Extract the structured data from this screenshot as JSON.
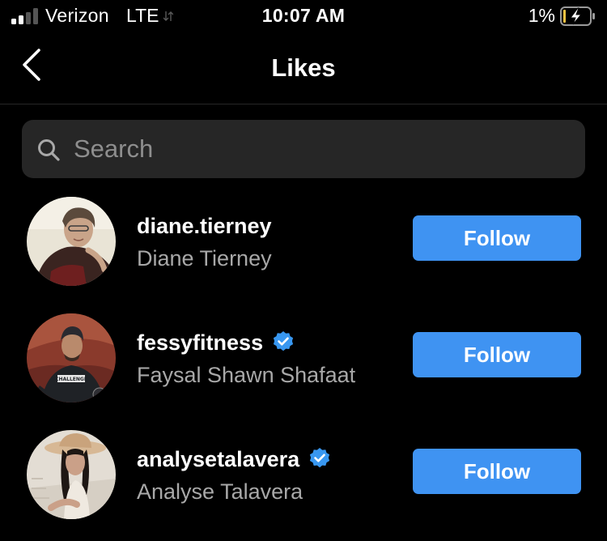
{
  "status_bar": {
    "carrier": "Verizon",
    "network": "LTE",
    "time": "10:07 AM",
    "battery": "1%",
    "signal_bars_filled": 2,
    "signal_bars_total": 4
  },
  "nav": {
    "title": "Likes",
    "back_icon": "chevron-left-icon"
  },
  "search": {
    "placeholder": "Search",
    "value": ""
  },
  "likes": [
    {
      "username": "diane.tierney",
      "full_name": "Diane Tierney",
      "verified": false,
      "button_label": "Follow"
    },
    {
      "username": "fessyfitness",
      "full_name": "Faysal Shawn Shafaat",
      "verified": true,
      "button_label": "Follow"
    },
    {
      "username": "analysetalavera",
      "full_name": "Analyse Talavera",
      "verified": true,
      "button_label": "Follow"
    }
  ],
  "colors": {
    "background": "#000000",
    "search_background": "#262626",
    "follow_button": "#3f93f2",
    "verified_badge": "#3897f0",
    "secondary_text": "#a8a8a8",
    "battery_charging": "#f5c242"
  }
}
